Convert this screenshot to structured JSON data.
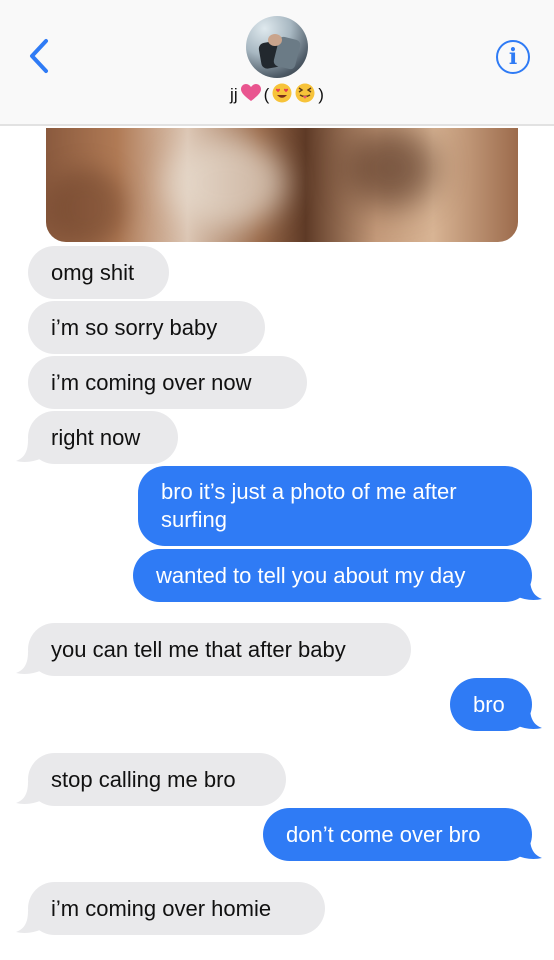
{
  "header": {
    "contact_name": "jj",
    "name_suffix_open": "(",
    "name_suffix_close": ")",
    "icons": [
      "chevron-left-icon",
      "info-icon",
      "pink-heart-emoji",
      "heart-eyes-emoji",
      "squinting-tongue-emoji"
    ],
    "info_glyph": "i"
  },
  "colors": {
    "accent": "#2f7bf5",
    "received_bubble": "#e9e9eb",
    "background": "#ffffff"
  },
  "messages": [
    {
      "from": "contact",
      "text": "omg shit"
    },
    {
      "from": "contact",
      "text": "i’m so sorry baby"
    },
    {
      "from": "contact",
      "text": "i’m coming over now"
    },
    {
      "from": "contact",
      "text": "right now"
    },
    {
      "from": "me",
      "text": "bro it’s just a photo of me after surfing"
    },
    {
      "from": "me",
      "text": "wanted to tell you about my day"
    },
    {
      "from": "contact",
      "text": "you can tell me that after baby"
    },
    {
      "from": "me",
      "text": "bro"
    },
    {
      "from": "contact",
      "text": "stop calling me bro"
    },
    {
      "from": "me",
      "text": "don’t come over bro"
    },
    {
      "from": "contact",
      "text": "i’m coming over homie"
    }
  ]
}
